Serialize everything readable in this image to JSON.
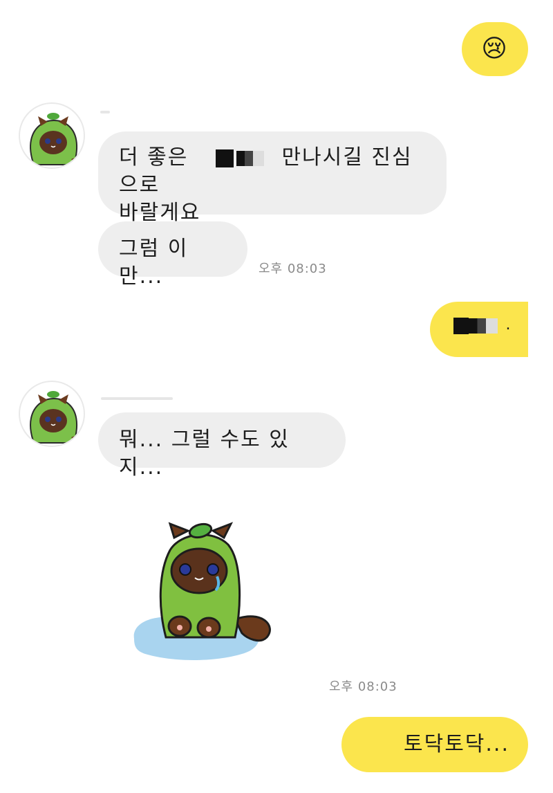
{
  "messages": {
    "m1_emoji": "😢",
    "m2_prefix": "더 좋은",
    "m2_suffix": "만나시길 진심으로",
    "m2_line2": "바랄게요",
    "m3": "그럼 이만...",
    "m3_time": "오후 08:03",
    "m4_tail": ".",
    "m5": "뭐... 그럴 수도 있지...",
    "sticker_time": "오후 08:03",
    "m6": "토닥토닥..."
  },
  "colors": {
    "incoming_bubble": "#eeeeee",
    "outgoing_bubble": "#fbe54d",
    "timestamp": "#8a8a8a"
  },
  "icons": {
    "avatar": "green-leaf-raccoon-cat-avatar",
    "sticker": "crying-cat-in-green-costume-sticker"
  }
}
